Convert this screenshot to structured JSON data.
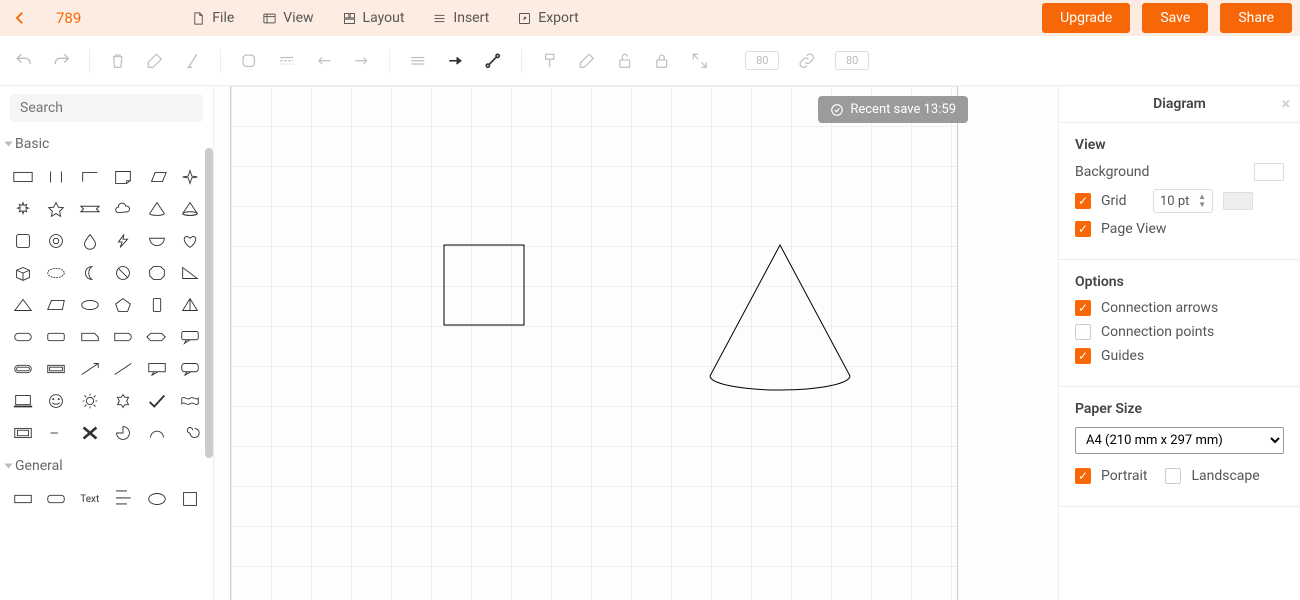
{
  "header": {
    "doc_title": "789",
    "menu": {
      "file": "File",
      "view": "View",
      "layout": "Layout",
      "insert": "Insert",
      "export": "Export"
    },
    "buttons": {
      "upgrade": "Upgrade",
      "save": "Save",
      "share": "Share"
    }
  },
  "toolbar": {
    "dim1": "80",
    "dim2": "80"
  },
  "sidebar": {
    "search_placeholder": "Search",
    "cat_basic": "Basic",
    "cat_general": "General",
    "text_label": "Text"
  },
  "canvas": {
    "save_status": "Recent save 13:59"
  },
  "panel": {
    "title": "Diagram",
    "view_h": "View",
    "background": "Background",
    "grid": "Grid",
    "grid_val": "10 pt",
    "page_view": "Page View",
    "options_h": "Options",
    "conn_arrows": "Connection arrows",
    "conn_points": "Connection points",
    "guides": "Guides",
    "paper_h": "Paper Size",
    "paper_val": "A4 (210 mm x 297 mm)",
    "portrait": "Portrait",
    "landscape": "Landscape"
  }
}
